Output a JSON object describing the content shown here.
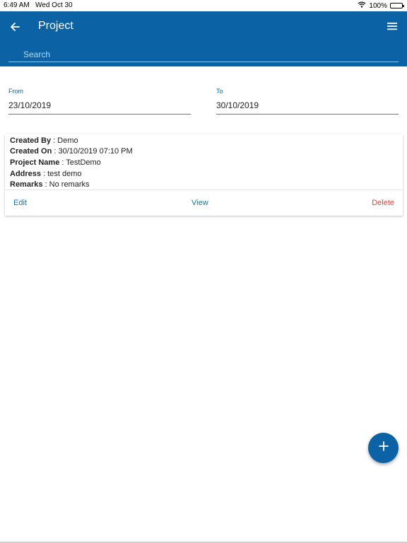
{
  "status_bar": {
    "time": "6:49 AM",
    "date": "Wed Oct 30",
    "battery": "100%"
  },
  "app_bar": {
    "title": "Project",
    "search_placeholder": "Search"
  },
  "filters": {
    "from_label": "From",
    "from_value": "23/10/2019",
    "to_label": "To",
    "to_value": "30/10/2019"
  },
  "card": {
    "rows": [
      {
        "label": "Created By",
        "value": ": Demo"
      },
      {
        "label": "Created On",
        "value": ": 30/10/2019 07:10 PM"
      },
      {
        "label": "Project Name",
        "value": ": TestDemo"
      },
      {
        "label": "Address",
        "value": ": test demo"
      },
      {
        "label": "Remarks",
        "value": ": No remarks"
      }
    ],
    "actions": {
      "edit": "Edit",
      "view": "View",
      "delete": "Delete"
    }
  },
  "colors": {
    "primary": "#0b63a5",
    "delete": "#d6453a",
    "underline": "#1e88e5"
  }
}
